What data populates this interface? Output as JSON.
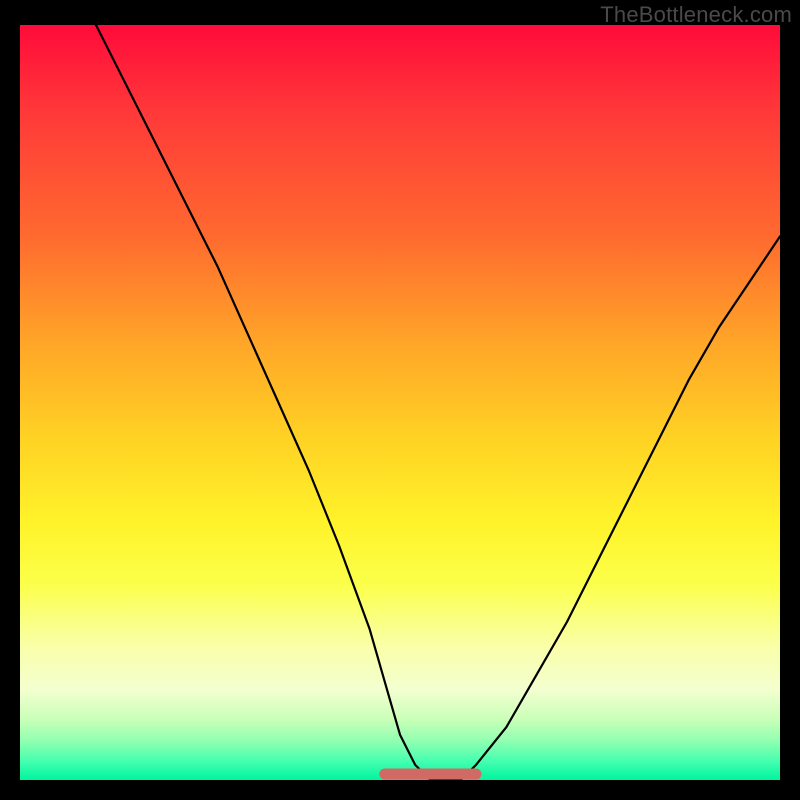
{
  "watermark": "TheBottleneck.com",
  "colors": {
    "page_bg": "#000000",
    "curve": "#000000",
    "flat_segment": "#cf6b64",
    "gradient_top": "#ff0b3a",
    "gradient_bottom": "#00f5a0"
  },
  "chart_data": {
    "type": "line",
    "title": "",
    "xlabel": "",
    "ylabel": "",
    "xlim": [
      0,
      100
    ],
    "ylim": [
      0,
      100
    ],
    "grid": false,
    "legend": false,
    "series": [
      {
        "name": "v-curve",
        "x": [
          10,
          14,
          18,
          22,
          26,
          30,
          34,
          38,
          42,
          46,
          48,
          50,
          52,
          54,
          56,
          58,
          60,
          64,
          68,
          72,
          76,
          80,
          84,
          88,
          92,
          96,
          100
        ],
        "values": [
          100,
          92,
          84,
          76,
          68,
          59,
          50,
          41,
          31,
          20,
          13,
          6,
          2,
          0,
          0,
          0,
          2,
          7,
          14,
          21,
          29,
          37,
          45,
          53,
          60,
          66,
          72
        ]
      }
    ],
    "flat_segment": {
      "x_start": 48,
      "x_end": 60,
      "y": 0,
      "color": "#cf6b64"
    }
  }
}
